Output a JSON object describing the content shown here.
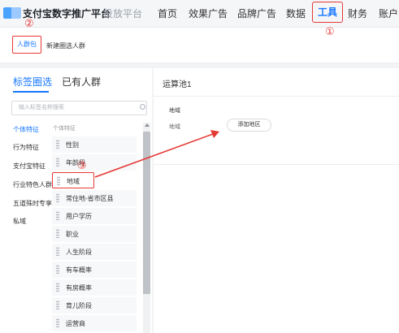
{
  "topnav": {
    "brand": "支付宝数字推广平台",
    "platform": "投放平台",
    "items": [
      "首页",
      "效果广告",
      "品牌广告",
      "数据",
      "工具",
      "财务",
      "账户"
    ],
    "active_index": 4
  },
  "subtabs": {
    "items": [
      "人群包",
      "新建圈选人群"
    ]
  },
  "annotations": [
    "①",
    "②",
    "③"
  ],
  "left_panel": {
    "tabs": [
      "标签圈选",
      "已有人群"
    ],
    "search_placeholder": "输入标签名称搜索",
    "categories": [
      "个体特征",
      "行为特征",
      "支付宝特征",
      "行业特色人群",
      "五道殊时专享",
      "私域"
    ],
    "subheading": "个体特征",
    "attributes": [
      "性别",
      "年龄段",
      "地域",
      "常住地-省市区县",
      "用户学历",
      "职业",
      "人生阶段",
      "有车概率",
      "有房概率",
      "育儿阶段",
      "运营商"
    ],
    "selected_attribute_index": 2
  },
  "right_panel": {
    "title": "运算池1",
    "card_title": "地域",
    "field_label": "地域",
    "add_button": "添加地区"
  },
  "colors": {
    "accent": "#1677ff",
    "annotation": "#e53935"
  }
}
